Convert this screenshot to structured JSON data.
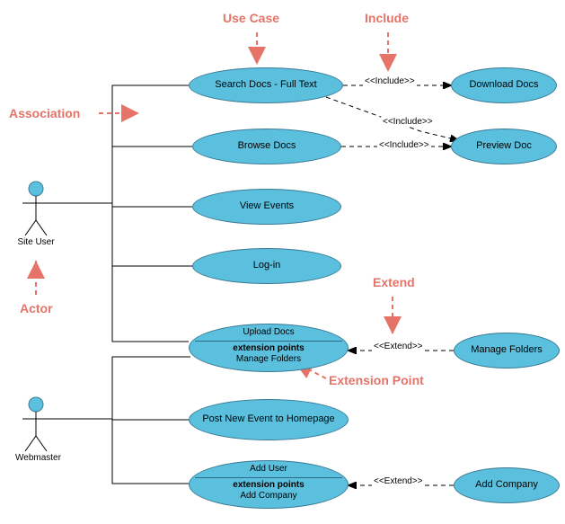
{
  "annotations": {
    "useCase": "Use Case",
    "include": "Include",
    "association": "Association",
    "actor": "Actor",
    "extend": "Extend",
    "extensionPoint": "Extension Point"
  },
  "actors": {
    "siteUser": "Site User",
    "webmaster": "Webmaster"
  },
  "useCases": {
    "searchDocs": "Search Docs - Full Text",
    "downloadDocs": "Download Docs",
    "browseDocs": "Browse Docs",
    "previewDoc": "Preview Doc",
    "viewEvents": "View Events",
    "login": "Log-in",
    "uploadDocs": {
      "title": "Upload Docs",
      "epHeader": "extension points",
      "epValue": "Manage Folders"
    },
    "manageFolders": "Manage Folders",
    "postEvent": "Post New Event to Homepage",
    "addUser": {
      "title": "Add User",
      "epHeader": "extension points",
      "epValue": "Add Company"
    },
    "addCompany": "Add Company"
  },
  "relLabels": {
    "include": "<<Include>>",
    "extend": "<<Extend>>"
  },
  "chart_data": {
    "type": "uml-use-case-diagram",
    "actors": [
      "Site User",
      "Webmaster"
    ],
    "useCases": [
      "Search Docs - Full Text",
      "Download Docs",
      "Browse Docs",
      "Preview Doc",
      "View Events",
      "Log-in",
      {
        "name": "Upload Docs",
        "extensionPoints": [
          "Manage Folders"
        ]
      },
      "Manage Folders",
      "Post New Event to Homepage",
      {
        "name": "Add User",
        "extensionPoints": [
          "Add Company"
        ]
      },
      "Add Company"
    ],
    "associations": [
      [
        "Site User",
        "Search Docs - Full Text"
      ],
      [
        "Site User",
        "Browse Docs"
      ],
      [
        "Site User",
        "View Events"
      ],
      [
        "Site User",
        "Log-in"
      ],
      [
        "Site User",
        "Upload Docs"
      ],
      [
        "Webmaster",
        "Upload Docs"
      ],
      [
        "Webmaster",
        "Post New Event to Homepage"
      ],
      [
        "Webmaster",
        "Add User"
      ]
    ],
    "includes": [
      [
        "Search Docs - Full Text",
        "Download Docs"
      ],
      [
        "Search Docs - Full Text",
        "Preview Doc"
      ],
      [
        "Browse Docs",
        "Preview Doc"
      ]
    ],
    "extends": [
      [
        "Manage Folders",
        "Upload Docs"
      ],
      [
        "Add Company",
        "Add User"
      ]
    ],
    "annotations": {
      "Use Case": "Search Docs - Full Text",
      "Include": "include relationship",
      "Association": "actor to use-case line",
      "Actor": "Site User",
      "Extend": "extend relationship",
      "Extension Point": "Upload Docs / Manage Folders"
    }
  }
}
